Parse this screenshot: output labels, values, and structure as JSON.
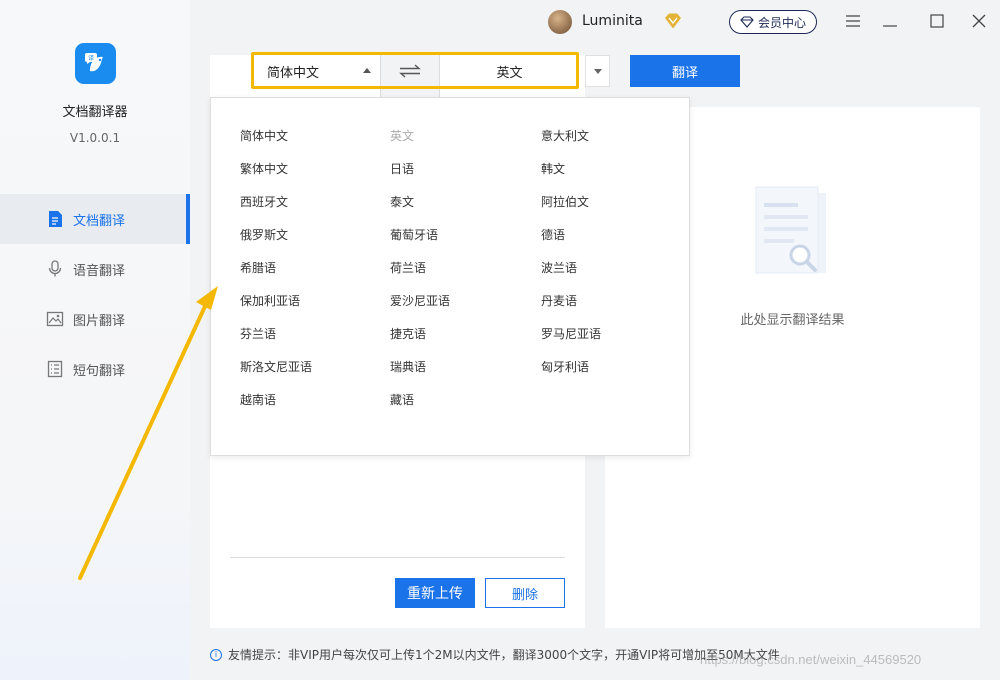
{
  "app": {
    "name": "文档翻译器",
    "version": "V1.0.0.1"
  },
  "sidebar": {
    "items": [
      {
        "label": "文档翻译",
        "icon": "document-icon",
        "active": true
      },
      {
        "label": "语音翻译",
        "icon": "microphone-icon",
        "active": false
      },
      {
        "label": "图片翻译",
        "icon": "image-icon",
        "active": false
      },
      {
        "label": "短句翻译",
        "icon": "text-icon",
        "active": false
      }
    ]
  },
  "header": {
    "username": "Luminita",
    "member_center": "会员中心",
    "window_controls": [
      "menu-icon",
      "minimize-icon",
      "maximize-icon",
      "close-icon"
    ]
  },
  "translator": {
    "source_lang": "简体中文",
    "target_lang": "英文",
    "translate_label": "翻译"
  },
  "dropdown": {
    "columns": [
      [
        "简体中文",
        "繁体中文",
        "西班牙文",
        "俄罗斯文",
        "希腊语",
        "保加利亚语",
        "芬兰语",
        "斯洛文尼亚语",
        "越南语"
      ],
      [
        "英文",
        "日语",
        "泰文",
        "葡萄牙语",
        "荷兰语",
        "爱沙尼亚语",
        "捷克语",
        "瑞典语",
        "藏语"
      ],
      [
        "意大利文",
        "韩文",
        "阿拉伯文",
        "德语",
        "波兰语",
        "丹麦语",
        "罗马尼亚语",
        "匈牙利语"
      ]
    ],
    "disabled": "英文"
  },
  "upload": {
    "reupload_label": "重新上传",
    "delete_label": "删除"
  },
  "result": {
    "placeholder": "此处显示翻译结果"
  },
  "footer": {
    "tip": "友情提示：非VIP用户每次仅可上传1个2M以内文件，翻译3000个文字，开通VIP将可增加至50M大文件",
    "watermark": "https://blog.csdn.net/weixin_44569520"
  },
  "colors": {
    "accent": "#1a73e8",
    "highlight": "#f5b800"
  }
}
